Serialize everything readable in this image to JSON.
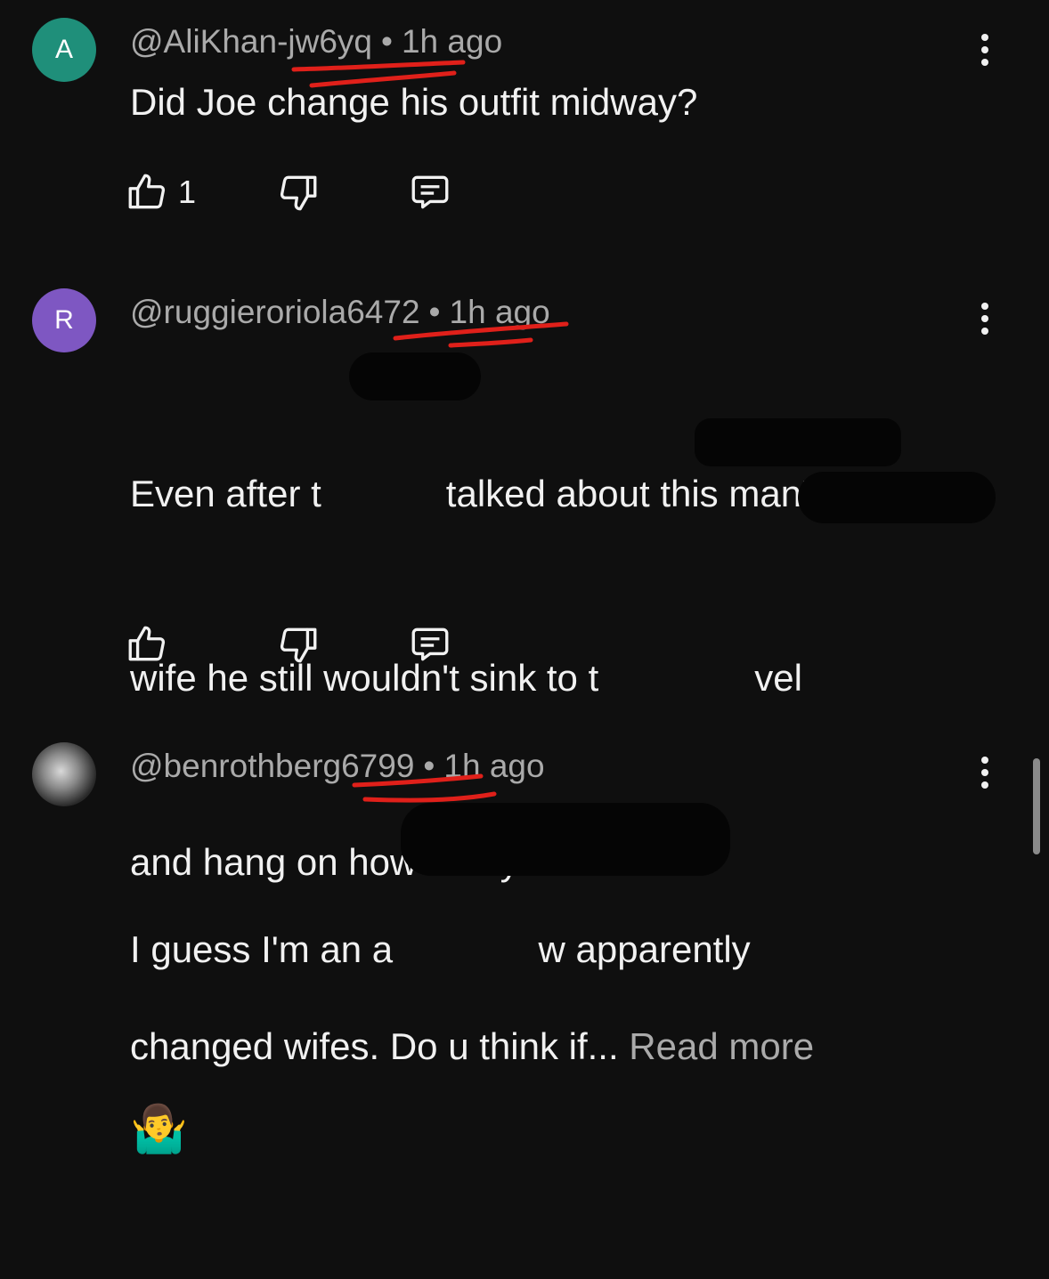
{
  "comments": [
    {
      "avatar_initial": "A",
      "avatar_color": "#1f8f7a",
      "handle": "@AliKhan-jw6yq",
      "separator": "•",
      "time": "1h ago",
      "text_lines": [
        "Did Joe change his outfit midway?"
      ],
      "likes": "1",
      "more_icon": "more-vert-icon"
    },
    {
      "avatar_initial": "R",
      "avatar_color": "#7e57c2",
      "handle": "@ruggieroriola6472",
      "separator": "•",
      "time": "1h ago",
      "text_lines": [
        "Even after t            talked about this man's",
        "wife he still wouldn't sink to t               vel",
        "and hang on how many times has",
        "changed wifes. Do u think if..."
      ],
      "read_more": "Read more",
      "likes": "",
      "more_icon": "more-vert-icon"
    },
    {
      "avatar_initial": "",
      "handle": "@benrothberg6799",
      "separator": "•",
      "time": "1h ago",
      "text_lines": [
        "I guess I'm an a              w apparently"
      ],
      "emoji": "🤷‍♂️",
      "more_icon": "more-vert-icon"
    }
  ],
  "colors": {
    "background": "#0f0f0f",
    "text": "#f1f1f1",
    "secondary": "#aaaaaa",
    "annotation": "#e0201a"
  },
  "icons": [
    "thumbs-up-icon",
    "thumbs-down-icon",
    "reply-icon",
    "more-vert-icon"
  ]
}
